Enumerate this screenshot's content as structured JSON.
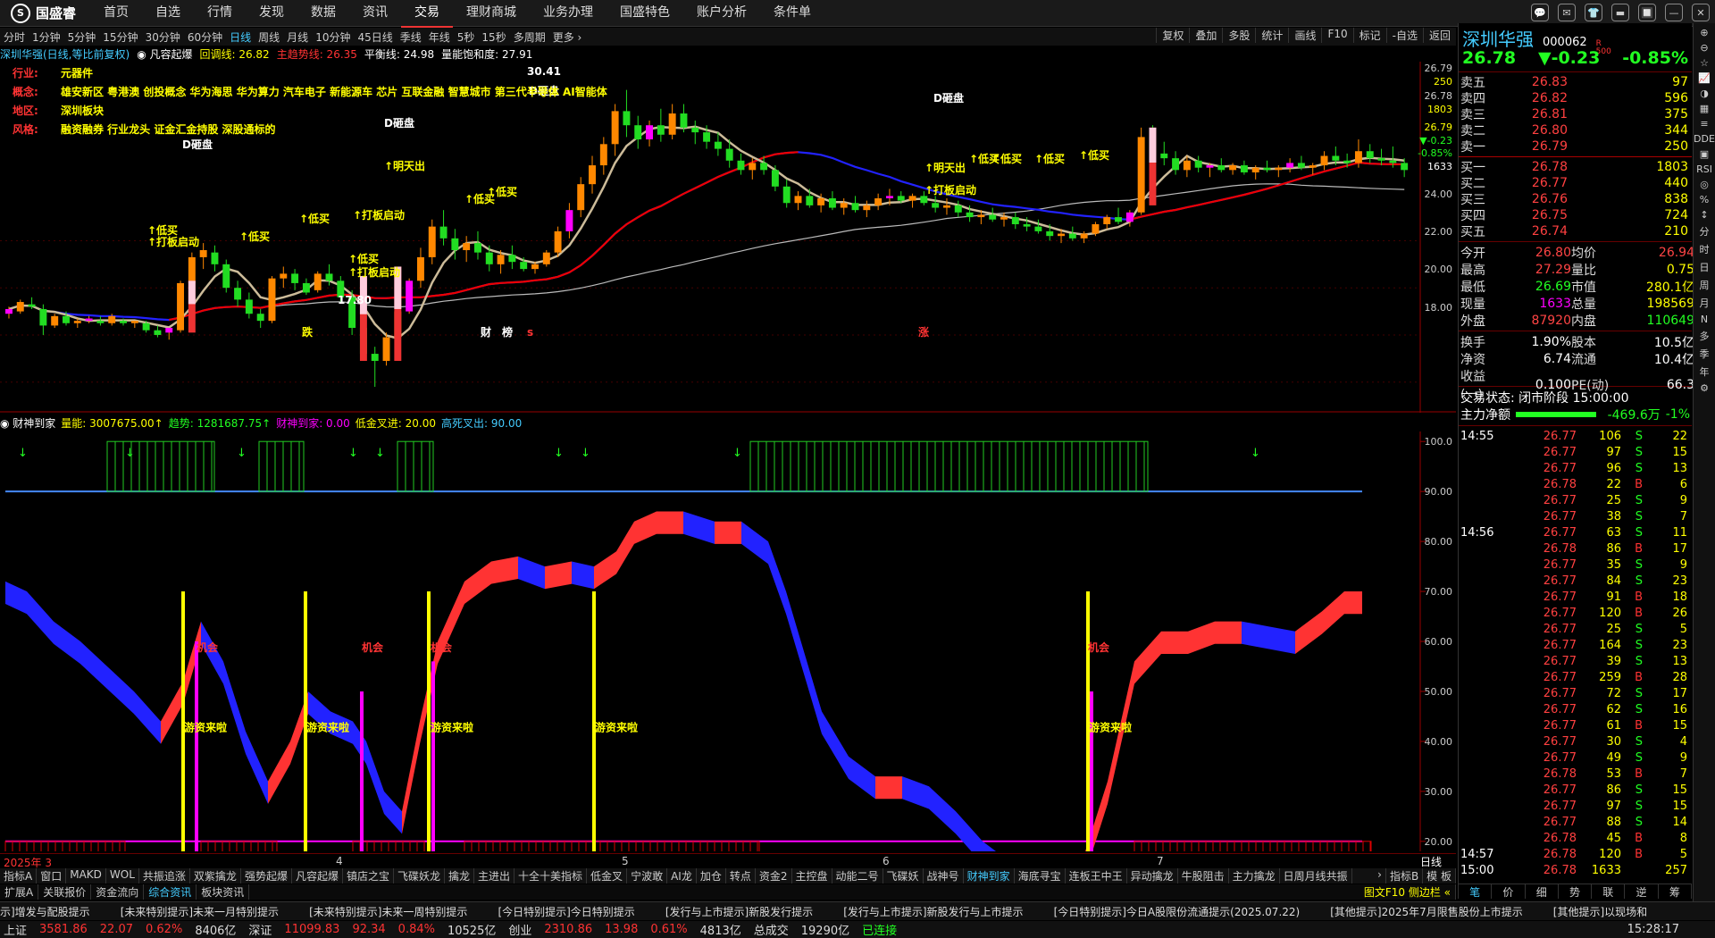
{
  "app": {
    "logo": "国盛睿",
    "logo_mark": "S"
  },
  "topmenu": [
    "首页",
    "自选",
    "行情",
    "发现",
    "数据",
    "资讯",
    "交易",
    "理财商城",
    "业务办理",
    "国盛特色",
    "账户分析",
    "条件单"
  ],
  "topmenu_active": 6,
  "winctl": [
    "💬",
    "✉",
    "👕",
    "▬",
    "🔲",
    "—",
    "✕"
  ],
  "periods": [
    "分时",
    "1分钟",
    "5分钟",
    "15分钟",
    "30分钟",
    "60分钟",
    "日线",
    "周线",
    "月线",
    "10分钟",
    "45日线",
    "季线",
    "年线",
    "5秒",
    "15秒",
    "多周期",
    "更多 ›"
  ],
  "period_active": 6,
  "rtools": [
    "复权",
    "叠加",
    "多股",
    "统计",
    "画线",
    "F10",
    "标记",
    "-自选",
    "返回"
  ],
  "chart_info": {
    "name": "深圳华强(日线,等比前复权)",
    "ind": "◉ 凡容起爆",
    "hui": "回调线: 26.82",
    "zhu": "主趋势线: 26.35",
    "ping": "平衡线: 24.98",
    "liang": "量能饱和度: 27.91"
  },
  "notes": [
    {
      "k": "行业:",
      "v": "元器件"
    },
    {
      "k": "概念:",
      "v": "雄安新区 粤港澳 创投概念 华为海思 华为算力 汽车电子 新能源车 芯片 互联金融 智慧城市 第三代半导体 AI智能体"
    },
    {
      "k": "地区:",
      "v": "深圳板块"
    },
    {
      "k": "风格:",
      "v": "融资融券 行业龙头 证金汇金持股 深股通标的"
    }
  ],
  "price_axis": [
    "26.79",
    "250",
    "26.78",
    "1803",
    "26.79",
    "▼-0.23",
    "-0.85%",
    "1633",
    "24.00",
    "22.00",
    "20.00",
    "18.00"
  ],
  "annot": {
    "hi": "30.41",
    "lo": "17.80",
    "d": "D砸盘",
    "buy": "↑低买",
    "da": "↑打板启动",
    "ming": "↑明天出",
    "die": "跌",
    "zhang": "涨",
    "cai": "财",
    "bang": "榜",
    "s": "s"
  },
  "ind_info": {
    "name": "◉ 财神到家",
    "liang": "量能: 3007675.00↑",
    "trend": "趋势: 1281687.75↑",
    "cs": "财神到家: 0.00",
    "lj": "低金叉进: 20.00",
    "gs": "高死叉出: 90.00"
  },
  "ind_axis": [
    "100.0",
    "90.00",
    "80.00",
    "70.00",
    "60.00",
    "50.00",
    "40.00",
    "30.00",
    "20.00"
  ],
  "ind_labels": {
    "ji": "机会",
    "yz": "游资来啦"
  },
  "dates": [
    "2025年 3",
    "4",
    "5",
    "6",
    "7"
  ],
  "date_corner": "日线",
  "tabs": [
    "指标A",
    "窗口",
    "MAKD",
    "WOL",
    "共振追涨",
    "双紫擒龙",
    "强势起爆",
    "凡容起爆",
    "镇店之宝",
    "飞碟妖龙",
    "擒龙",
    "主进出",
    "十全十美指标",
    "低金叉",
    "宁波敢",
    "AI龙",
    "加仓",
    "转点",
    "资金2",
    "主控盘",
    "动能二号",
    "飞碟妖",
    "战神号",
    "财神到家",
    "海底寻宝",
    "连板王中王",
    "异动擒龙",
    "牛股阻击",
    "主力擒龙",
    "日周月线共振"
  ],
  "tab_active": 23,
  "tab_end": [
    "指标B",
    "模 板"
  ],
  "tabs2": [
    "扩展A",
    "关联报价",
    "资金流向",
    "综合资讯",
    "板块资讯"
  ],
  "tab2_active": 3,
  "tab2_right": "图文F10 侧边栏 «",
  "ticker": [
    "示]增发与配股提示",
    "[未来特别提示]未来一月特别提示",
    "[未来特别提示]未来一周特别提示",
    "[今日特别提示]今日特别提示",
    "[发行与上市提示]新股发行提示",
    "[发行与上市提示]新股发行与上市提示",
    "[今日特别提示]今日A股限份流通提示(2025.07.22)",
    "[其他提示]2025年7月限售股份上市提示",
    "[其他提示]以现场和"
  ],
  "status": {
    "sh": "上证",
    "sh_v": "3581.86",
    "sh_c": "22.07",
    "sh_p": "0.62%",
    "sh_a": "8406亿",
    "sz": "深证",
    "sz_v": "11099.83",
    "sz_c": "92.34",
    "sz_p": "0.84%",
    "sz_a": "10525亿",
    "cy": "创业",
    "cy_v": "2310.86",
    "cy_c": "13.98",
    "cy_p": "0.61%",
    "cy_a": "4813亿",
    "tot": "总成交",
    "tot_v": "19290亿",
    "conn": "已连接",
    "time": "15:28:17"
  },
  "quote": {
    "name": "深圳华强",
    "code": "000062",
    "tag": "R\n500",
    "price": "26.78",
    "chg": "▼-0.23",
    "pct": "-0.85%"
  },
  "sells": [
    [
      "卖五",
      "26.83",
      "97"
    ],
    [
      "卖四",
      "26.82",
      "596"
    ],
    [
      "卖三",
      "26.81",
      "375"
    ],
    [
      "卖二",
      "26.80",
      "344"
    ],
    [
      "卖一",
      "26.79",
      "250"
    ]
  ],
  "buys": [
    [
      "买一",
      "26.78",
      "1803"
    ],
    [
      "买二",
      "26.77",
      "440"
    ],
    [
      "买三",
      "26.76",
      "838"
    ],
    [
      "买四",
      "26.75",
      "724"
    ],
    [
      "买五",
      "26.74",
      "210"
    ]
  ],
  "stats": [
    [
      "今开",
      "26.80",
      "均价",
      "26.94"
    ],
    [
      "最高",
      "27.29",
      "量比",
      "0.75"
    ],
    [
      "最低",
      "26.69",
      "市值",
      "280.1亿"
    ],
    [
      "现量",
      "1633",
      "总量",
      "198569"
    ],
    [
      "外盘",
      "87920",
      "内盘",
      "110649"
    ]
  ],
  "stats2": [
    [
      "换手",
      "1.90%",
      "股本",
      "10.5亿"
    ],
    [
      "净资",
      "6.74",
      "流通",
      "10.4亿"
    ],
    [
      "收益(一)",
      "0.100",
      "PE(动)",
      "66.3"
    ]
  ],
  "trade_state": "交易状态: 闭市阶段 15:00:00",
  "main_net": {
    "label": "主力净额",
    "val": "-469.6万",
    "pct": "-1%"
  },
  "ticks": [
    [
      "14:55",
      "26.77",
      "106",
      "S",
      "22"
    ],
    [
      "",
      "26.77",
      "97",
      "S",
      "15"
    ],
    [
      "",
      "26.77",
      "96",
      "S",
      "13"
    ],
    [
      "",
      "26.78",
      "22",
      "B",
      "6"
    ],
    [
      "",
      "26.77",
      "25",
      "S",
      "9"
    ],
    [
      "",
      "26.77",
      "38",
      "S",
      "7"
    ],
    [
      "14:56",
      "26.77",
      "63",
      "S",
      "11"
    ],
    [
      "",
      "26.78",
      "86",
      "B",
      "17"
    ],
    [
      "",
      "26.77",
      "35",
      "S",
      "9"
    ],
    [
      "",
      "26.77",
      "84",
      "S",
      "23"
    ],
    [
      "",
      "26.77",
      "91",
      "B",
      "18"
    ],
    [
      "",
      "26.77",
      "120",
      "B",
      "26"
    ],
    [
      "",
      "26.77",
      "25",
      "S",
      "5"
    ],
    [
      "",
      "26.77",
      "164",
      "S",
      "23"
    ],
    [
      "",
      "26.77",
      "39",
      "S",
      "13"
    ],
    [
      "",
      "26.77",
      "259",
      "B",
      "28"
    ],
    [
      "",
      "26.77",
      "72",
      "S",
      "17"
    ],
    [
      "",
      "26.77",
      "62",
      "S",
      "16"
    ],
    [
      "",
      "26.77",
      "61",
      "B",
      "15"
    ],
    [
      "",
      "26.77",
      "30",
      "S",
      "4"
    ],
    [
      "",
      "26.77",
      "49",
      "S",
      "9"
    ],
    [
      "",
      "26.78",
      "53",
      "B",
      "7"
    ],
    [
      "",
      "26.77",
      "86",
      "S",
      "15"
    ],
    [
      "",
      "26.77",
      "97",
      "S",
      "15"
    ],
    [
      "",
      "26.77",
      "88",
      "S",
      "14"
    ],
    [
      "",
      "26.78",
      "45",
      "B",
      "8"
    ],
    [
      "14:57",
      "26.78",
      "120",
      "B",
      "5"
    ],
    [
      "15:00",
      "26.78",
      "1633",
      "",
      "257"
    ]
  ],
  "rbar": [
    "⊕",
    "⊖",
    "☆",
    "📈",
    "◑",
    "▦",
    "≡",
    "DDE",
    "▣",
    "RSI",
    "◎",
    "%",
    "↕",
    "分",
    "时",
    "日",
    "周",
    "月",
    "N",
    "多",
    "季",
    "年",
    "⚙"
  ],
  "rtabs": [
    "笔",
    "价",
    "细",
    "势",
    "联",
    "逆",
    "筹"
  ],
  "candles": [
    [
      1,
      20.9,
      21.2,
      20.7,
      21.1
    ],
    [
      2,
      21.0,
      21.5,
      20.9,
      21.4
    ],
    [
      3,
      21.3,
      21.6,
      21.1,
      21.2
    ],
    [
      4,
      21.1,
      21.3,
      20.0,
      20.4
    ],
    [
      5,
      20.4,
      20.9,
      20.3,
      20.8
    ],
    [
      6,
      20.8,
      21.0,
      20.4,
      20.5
    ],
    [
      7,
      20.5,
      20.7,
      20.3,
      20.6
    ],
    [
      8,
      20.6,
      20.8,
      20.5,
      20.7
    ],
    [
      9,
      20.6,
      20.8,
      20.4,
      20.5
    ],
    [
      10,
      20.5,
      20.9,
      20.4,
      20.8
    ],
    [
      11,
      20.6,
      20.7,
      20.4,
      20.5
    ],
    [
      12,
      20.5,
      20.6,
      20.3,
      20.6
    ],
    [
      13,
      20.5,
      20.6,
      20.1,
      20.2
    ],
    [
      14,
      20.2,
      20.4,
      19.9,
      20.0
    ],
    [
      15,
      20.1,
      20.3,
      19.8,
      20.3
    ],
    [
      16,
      20.2,
      22.3,
      20.1,
      22.2
    ],
    [
      17,
      22.2,
      23.5,
      21.9,
      23.3
    ],
    [
      18,
      23.3,
      23.9,
      22.8,
      23.6
    ],
    [
      19,
      23.5,
      23.8,
      22.7,
      23.0
    ],
    [
      20,
      23.0,
      23.2,
      21.8,
      22.0
    ],
    [
      21,
      22.0,
      22.3,
      21.2,
      21.5
    ],
    [
      22,
      21.5,
      21.8,
      20.7,
      20.9
    ],
    [
      23,
      20.9,
      21.1,
      20.3,
      20.6
    ],
    [
      24,
      20.6,
      22.5,
      20.5,
      22.4
    ],
    [
      25,
      22.4,
      22.9,
      22.0,
      22.6
    ],
    [
      26,
      22.6,
      22.8,
      21.9,
      22.2
    ],
    [
      27,
      22.2,
      22.4,
      21.7,
      21.8
    ],
    [
      28,
      21.9,
      22.7,
      21.8,
      22.6
    ],
    [
      29,
      22.6,
      23.0,
      22.1,
      22.3
    ],
    [
      30,
      22.3,
      22.5,
      21.4,
      21.6
    ],
    [
      31,
      21.6,
      21.9,
      20.0,
      20.3
    ],
    [
      32,
      20.3,
      20.5,
      18.9,
      19.2
    ],
    [
      33,
      19.2,
      19.5,
      17.8,
      18.9
    ],
    [
      34,
      18.9,
      20.1,
      18.7,
      19.9
    ],
    [
      35,
      19.9,
      21.2,
      19.7,
      21.0
    ],
    [
      36,
      21.0,
      22.4,
      20.9,
      22.3
    ],
    [
      37,
      22.3,
      23.7,
      22.0,
      23.3
    ],
    [
      38,
      23.3,
      24.9,
      23.0,
      24.6
    ],
    [
      39,
      24.6,
      25.3,
      23.8,
      24.1
    ],
    [
      40,
      24.1,
      24.5,
      23.2,
      23.6
    ],
    [
      41,
      23.6,
      24.2,
      23.1,
      23.9
    ],
    [
      42,
      23.9,
      24.4,
      23.2,
      23.5
    ],
    [
      43,
      23.5,
      23.8,
      22.7,
      23.0
    ],
    [
      44,
      23.0,
      23.6,
      22.6,
      23.4
    ],
    [
      45,
      23.4,
      23.8,
      22.8,
      23.1
    ],
    [
      46,
      23.1,
      23.3,
      22.7,
      22.8
    ],
    [
      47,
      22.8,
      23.1,
      22.6,
      23.0
    ],
    [
      48,
      23.0,
      23.6,
      22.9,
      23.5
    ],
    [
      49,
      23.5,
      24.6,
      23.3,
      24.4
    ],
    [
      50,
      24.4,
      25.6,
      24.1,
      25.3
    ],
    [
      51,
      25.3,
      26.7,
      25.0,
      26.4
    ],
    [
      52,
      26.4,
      27.6,
      26.0,
      27.2
    ],
    [
      53,
      27.2,
      28.4,
      26.8,
      28.1
    ],
    [
      54,
      28.1,
      29.8,
      27.6,
      29.5
    ],
    [
      55,
      29.5,
      30.4,
      28.4,
      28.9
    ],
    [
      56,
      28.9,
      29.3,
      27.9,
      28.3
    ],
    [
      57,
      28.3,
      29.1,
      28.0,
      28.9
    ],
    [
      58,
      28.9,
      29.6,
      28.2,
      28.5
    ],
    [
      59,
      28.5,
      29.8,
      28.3,
      29.4
    ],
    [
      60,
      29.4,
      29.8,
      28.6,
      28.8
    ],
    [
      61,
      28.8,
      29.1,
      28.1,
      28.6
    ],
    [
      62,
      28.6,
      28.9,
      27.9,
      28.2
    ],
    [
      63,
      28.2,
      28.6,
      27.6,
      27.9
    ],
    [
      64,
      27.9,
      28.3,
      27.1,
      27.4
    ],
    [
      65,
      27.4,
      27.7,
      26.8,
      27.0
    ],
    [
      66,
      27.0,
      27.5,
      26.6,
      27.3
    ],
    [
      67,
      27.3,
      27.6,
      26.8,
      27.0
    ],
    [
      68,
      27.0,
      27.2,
      26.1,
      26.3
    ],
    [
      69,
      26.3,
      26.6,
      25.4,
      25.6
    ],
    [
      70,
      25.6,
      26.1,
      25.3,
      25.9
    ],
    [
      71,
      25.9,
      26.2,
      25.4,
      25.5
    ],
    [
      72,
      25.5,
      26.0,
      25.2,
      25.8
    ],
    [
      73,
      25.8,
      26.1,
      25.3,
      25.4
    ],
    [
      74,
      25.4,
      25.8,
      25.1,
      25.6
    ],
    [
      75,
      25.6,
      25.9,
      25.2,
      25.3
    ],
    [
      76,
      25.3,
      25.7,
      25.0,
      25.5
    ],
    [
      77,
      25.5,
      26.0,
      25.3,
      25.8
    ],
    [
      78,
      25.8,
      26.2,
      25.5,
      25.9
    ],
    [
      79,
      25.9,
      26.1,
      25.6,
      25.7
    ],
    [
      80,
      25.7,
      26.0,
      25.4,
      25.9
    ],
    [
      81,
      25.9,
      26.1,
      25.5,
      25.6
    ],
    [
      82,
      25.6,
      25.9,
      25.2,
      25.4
    ],
    [
      83,
      25.4,
      25.8,
      25.1,
      25.5
    ],
    [
      84,
      25.5,
      25.7,
      25.0,
      25.2
    ],
    [
      85,
      25.2,
      25.5,
      24.8,
      25.0
    ],
    [
      86,
      25.0,
      25.3,
      24.7,
      25.1
    ],
    [
      87,
      25.1,
      25.4,
      24.8,
      24.9
    ],
    [
      88,
      24.9,
      25.2,
      24.6,
      25.0
    ],
    [
      89,
      25.0,
      25.2,
      24.5,
      24.7
    ],
    [
      90,
      24.7,
      25.0,
      24.4,
      24.6
    ],
    [
      91,
      24.6,
      24.9,
      24.3,
      24.4
    ],
    [
      92,
      24.4,
      24.7,
      24.0,
      24.2
    ],
    [
      93,
      24.2,
      24.5,
      23.9,
      24.3
    ],
    [
      94,
      24.3,
      24.6,
      24.0,
      24.1
    ],
    [
      95,
      24.1,
      24.4,
      23.9,
      24.3
    ],
    [
      96,
      24.3,
      24.8,
      24.2,
      24.7
    ],
    [
      97,
      24.7,
      25.1,
      24.5,
      25.0
    ],
    [
      98,
      25.0,
      25.4,
      24.7,
      24.8
    ],
    [
      99,
      24.8,
      25.3,
      24.6,
      25.2
    ],
    [
      100,
      25.2,
      28.8,
      25.1,
      28.4
    ],
    [
      101,
      28.4,
      28.9,
      27.3,
      27.7
    ],
    [
      102,
      27.7,
      28.2,
      27.2,
      27.5
    ],
    [
      103,
      27.5,
      27.8,
      26.8,
      27.0
    ],
    [
      104,
      27.0,
      27.6,
      26.7,
      27.4
    ],
    [
      105,
      27.4,
      27.6,
      26.9,
      27.1
    ],
    [
      106,
      27.1,
      27.3,
      26.7,
      27.2
    ],
    [
      107,
      27.2,
      27.5,
      26.9,
      27.0
    ],
    [
      108,
      27.0,
      27.3,
      26.8,
      27.2
    ],
    [
      109,
      27.2,
      27.4,
      26.8,
      26.9
    ],
    [
      110,
      26.9,
      27.2,
      26.6,
      27.1
    ],
    [
      111,
      27.1,
      27.4,
      26.9,
      27.0
    ],
    [
      112,
      27.0,
      27.2,
      26.7,
      27.1
    ],
    [
      113,
      27.1,
      27.5,
      26.9,
      27.3
    ],
    [
      114,
      27.3,
      27.6,
      27.0,
      27.1
    ],
    [
      115,
      27.1,
      27.3,
      26.8,
      27.2
    ],
    [
      116,
      27.2,
      27.8,
      27.0,
      27.6
    ],
    [
      117,
      27.6,
      28.0,
      27.2,
      27.4
    ],
    [
      118,
      27.4,
      27.7,
      27.1,
      27.3
    ],
    [
      119,
      27.3,
      28.3,
      27.1,
      27.8
    ],
    [
      120,
      27.8,
      28.1,
      27.3,
      27.5
    ],
    [
      121,
      27.5,
      27.9,
      27.2,
      27.4
    ],
    [
      122,
      27.4,
      28.0,
      27.1,
      27.3
    ],
    [
      123,
      27.3,
      27.5,
      26.7,
      27.0
    ]
  ]
}
